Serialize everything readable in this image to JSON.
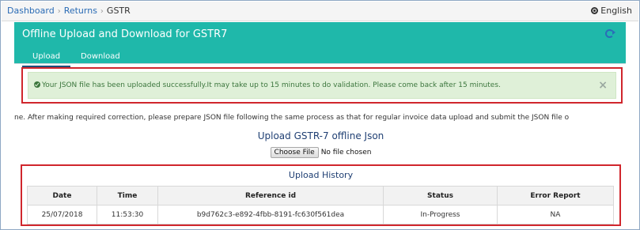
{
  "breadcrumb": {
    "items": [
      "Dashboard",
      "Returns",
      "GSTR"
    ],
    "language": "English"
  },
  "panel": {
    "title": "Offline Upload and Download for GSTR7",
    "tabs": [
      "Upload",
      "Download"
    ],
    "active_tab": "Upload"
  },
  "alert": {
    "message": "Your JSON file has been uploaded successfully.It may take up to 15 minutes to do validation. Please come back after 15 minutes.",
    "close_symbol": "×"
  },
  "instructions": "ne. After making required correction, please prepare JSON file following the same process as that for regular invoice data upload and submit the JSON file o",
  "upload": {
    "title": "Upload GSTR-7 offline Json",
    "choose_label": "Choose File",
    "file_status": "No file chosen"
  },
  "history": {
    "title": "Upload History",
    "columns": [
      "Date",
      "Time",
      "Reference id",
      "Status",
      "Error Report"
    ],
    "rows": [
      [
        "25/07/2018",
        "11:53:30",
        "b9d762c3-e892-4fbb-8191-fc630f561dea",
        "In-Progress",
        "NA"
      ]
    ]
  },
  "colors": {
    "header": "#1fb8aa",
    "alert_bg": "#dff0d8",
    "alert_text": "#3c763d",
    "highlight_border": "#d0262d",
    "title_blue": "#1f3f73"
  }
}
